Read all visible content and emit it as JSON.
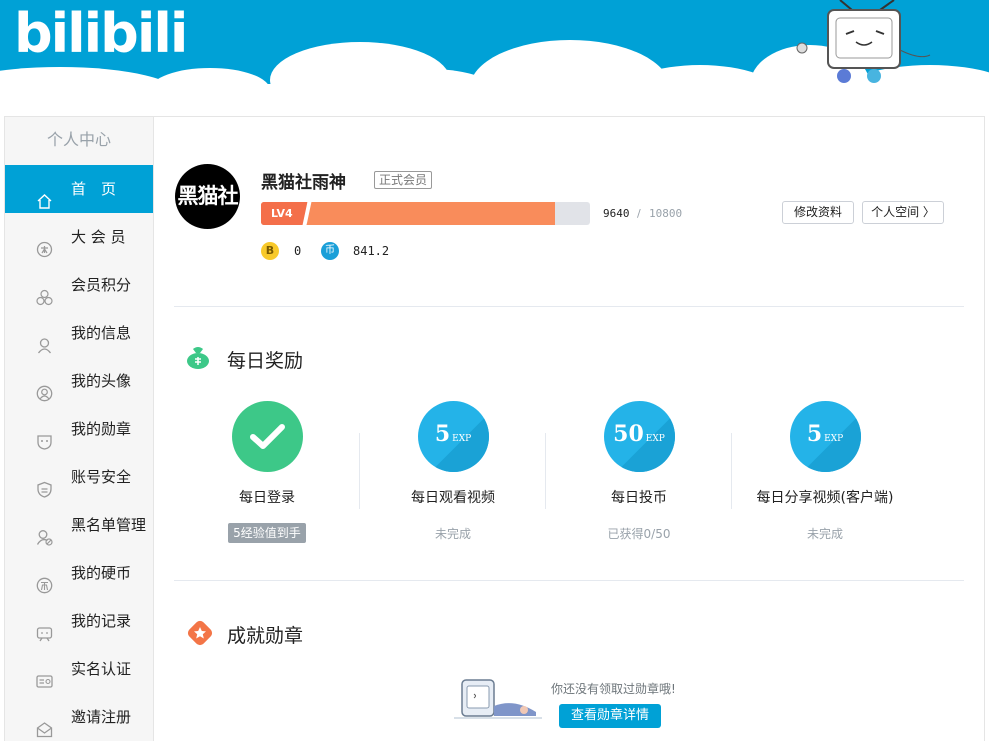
{
  "header": {
    "logo": "bilibili"
  },
  "sidebar": {
    "title": "个人中心",
    "items": [
      {
        "label": "首　页",
        "icon": "home-icon",
        "active": true
      },
      {
        "label": "大 会 员",
        "icon": "vip-icon",
        "active": false
      },
      {
        "label": "会员积分",
        "icon": "points-icon",
        "active": false
      },
      {
        "label": "我的信息",
        "icon": "user-info-icon",
        "active": false
      },
      {
        "label": "我的头像",
        "icon": "avatar-icon",
        "active": false
      },
      {
        "label": "我的勋章",
        "icon": "medal-icon",
        "active": false
      },
      {
        "label": "账号安全",
        "icon": "shield-icon",
        "active": false
      },
      {
        "label": "黑名单管理",
        "icon": "blacklist-icon",
        "active": false
      },
      {
        "label": "我的硬币",
        "icon": "coin-icon",
        "active": false
      },
      {
        "label": "我的记录",
        "icon": "record-icon",
        "active": false
      },
      {
        "label": "实名认证",
        "icon": "id-card-icon",
        "active": false
      },
      {
        "label": "邀请注册",
        "icon": "invite-icon",
        "active": false
      }
    ]
  },
  "profile": {
    "avatar_text": "黑猫社",
    "username": "黑猫社雨神",
    "member_badge": "正式会员",
    "level": "LV4",
    "exp_current": "9640",
    "exp_sep": "/",
    "exp_max": "10800",
    "exp_fraction": 0.8926,
    "edit_label": "修改资料",
    "space_label": "个人空间 〉",
    "b_coin_symbol": "B",
    "b_coin": "0",
    "coin_symbol": "币",
    "coins": "841.2"
  },
  "daily": {
    "title": "每日奖励",
    "rewards": [
      {
        "name": "每日登录",
        "done": true,
        "exp": "",
        "status": "5经验值到手"
      },
      {
        "name": "每日观看视频",
        "done": false,
        "exp": "5",
        "status": "未完成"
      },
      {
        "name": "每日投币",
        "done": false,
        "exp": "50",
        "status": "已获得0/50"
      },
      {
        "name": "每日分享视频(客户端)",
        "done": false,
        "exp": "5",
        "status": "未完成"
      }
    ],
    "exp_unit": "EXP"
  },
  "medals": {
    "title": "成就勋章",
    "empty_text": "你还没有领取过勋章哦!",
    "button": "查看勋章详情"
  },
  "colors": {
    "brand": "#00a1d6",
    "level_fill": "#f98c5b",
    "done_green": "#3dc888"
  }
}
